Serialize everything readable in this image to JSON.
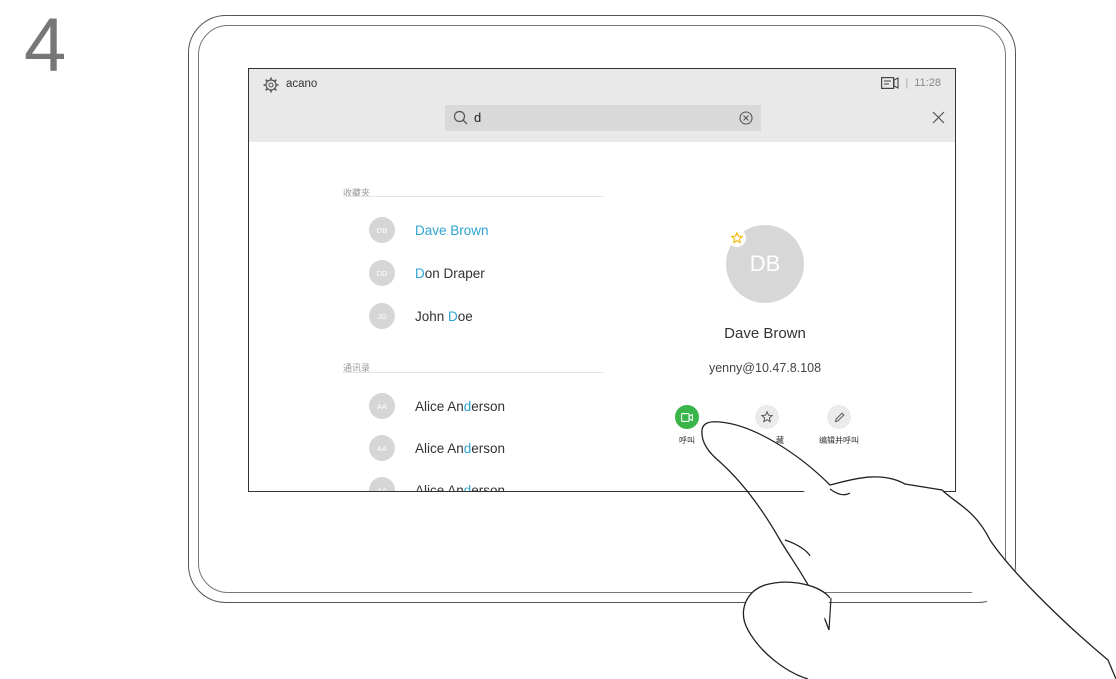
{
  "step": {
    "number": "4"
  },
  "topbar": {
    "site_name": "acano",
    "time": "11:28",
    "separator": "|"
  },
  "search": {
    "query": "d"
  },
  "favorites": {
    "label": "收藏夹",
    "items": [
      {
        "initials": "DB",
        "name_highlight": "Dave Brown",
        "name_rest": "",
        "name_prefix": ""
      },
      {
        "initials": "DD",
        "name_prefix": "",
        "name_highlight": "D",
        "name_rest": "on Draper"
      },
      {
        "initials": "JD",
        "name_prefix": "John ",
        "name_highlight": "D",
        "name_rest": "oe"
      }
    ]
  },
  "directory": {
    "label": "通讯录",
    "items": [
      {
        "initials": "AA",
        "name_prefix": "Alice An",
        "name_highlight": "d",
        "name_rest": "erson"
      },
      {
        "initials": "AA",
        "name_prefix": "Alice An",
        "name_highlight": "d",
        "name_rest": "erson"
      },
      {
        "initials": "AA",
        "name_prefix": "Alice An",
        "name_highlight": "d",
        "name_rest": "erson"
      }
    ]
  },
  "detail": {
    "initials": "DB",
    "name": "Dave Brown",
    "address": "yenny@10.47.8.108",
    "actions": {
      "call_label": "呼叫",
      "favorite_label": "藏",
      "edit_call_label": "编辑并呼叫"
    }
  },
  "colors": {
    "accent": "#2ea3d2",
    "call_green": "#39b54a",
    "star_yellow": "#f2b705"
  }
}
